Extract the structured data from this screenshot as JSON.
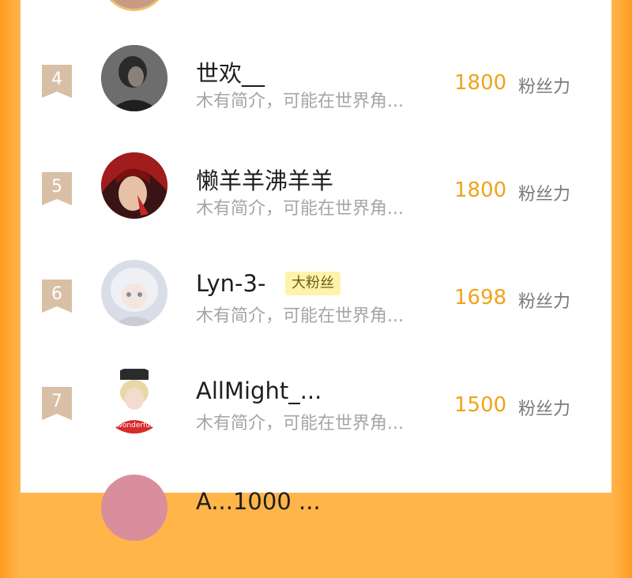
{
  "unit_label": "粉丝力",
  "rows": [
    {
      "rank": "4",
      "name": "世欢__",
      "bio": "木有简介，可能在世界角...",
      "count": "1800",
      "avatar": "avatar-dark-hair"
    },
    {
      "rank": "5",
      "name": "懒羊羊沸羊羊",
      "bio": "木有简介，可能在世界角...",
      "count": "1800",
      "avatar": "avatar-red-hair"
    },
    {
      "rank": "6",
      "name": "Lyn-3-",
      "tag": "大粉丝",
      "bio": "木有简介，可能在世界角...",
      "count": "1698",
      "avatar": "avatar-white-hair"
    },
    {
      "rank": "7",
      "name": "AllMight_...",
      "bio": "木有简介，可能在世界角...",
      "count": "1500",
      "avatar": "avatar-wonderful"
    },
    {
      "rank": "",
      "name": "A...1000 ...",
      "bio": "",
      "count": "",
      "avatar": "avatar-pink"
    }
  ],
  "colors": {
    "accent": "#f1a21a",
    "frame": "#ffb54a",
    "badge": "#d8bfa5"
  }
}
